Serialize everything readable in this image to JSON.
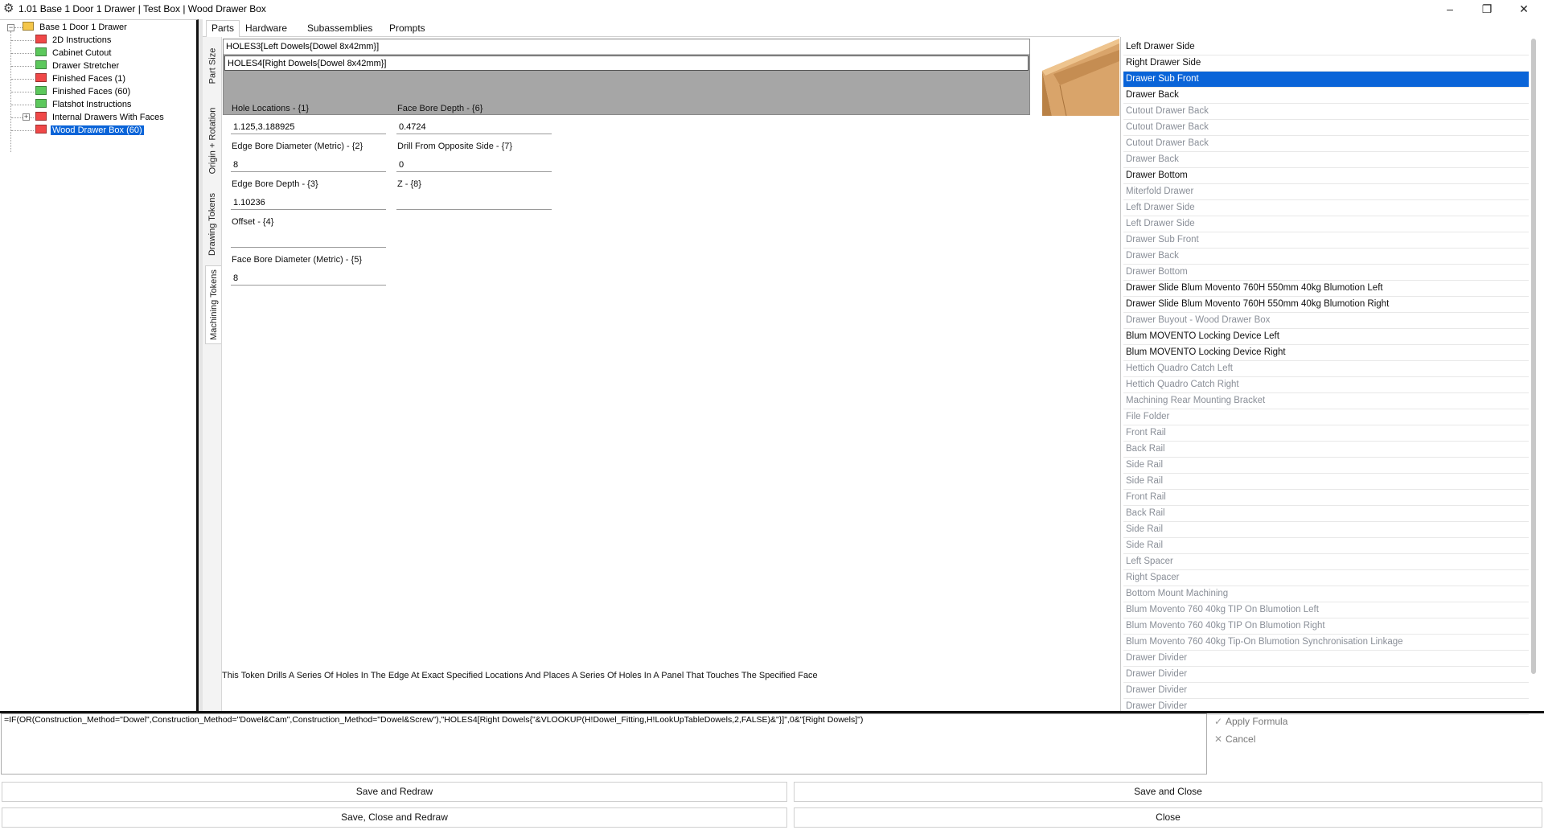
{
  "window": {
    "title": "1.01 Base 1 Door 1 Drawer | Test Box | Wood Drawer Box",
    "app_icon": "gear-icon",
    "controls": {
      "minimize": "–",
      "maximize": "❐",
      "close": "✕"
    }
  },
  "tree": {
    "root": {
      "label": "Base 1 Door 1 Drawer",
      "icon": "folder-open-icon"
    },
    "items": [
      {
        "label": "2D Instructions",
        "color": "red"
      },
      {
        "label": "Cabinet Cutout",
        "color": "green"
      },
      {
        "label": "Drawer Stretcher",
        "color": "green"
      },
      {
        "label": "Finished Faces (1)",
        "color": "red"
      },
      {
        "label": "Finished Faces (60)",
        "color": "green"
      },
      {
        "label": "Flatshot Instructions",
        "color": "green"
      },
      {
        "label": "Internal Drawers With Faces",
        "color": "red",
        "expandable": true
      },
      {
        "label": "Wood Drawer Box (60)",
        "color": "red",
        "selected": true
      }
    ]
  },
  "top_tabs": [
    "Parts",
    "Hardware",
    "Subassemblies",
    "Prompts"
  ],
  "vertical_tabs": [
    "Part Size",
    "Origin + Rotation",
    "Drawing Tokens",
    "Machining Tokens"
  ],
  "tokens": [
    "HOLES3[Left Dowels{Dowel 8x42mm}]",
    "HOLES4[Right Dowels{Dowel 8x42mm}]"
  ],
  "fields": {
    "hole_locations": {
      "label": "Hole Locations - {1}",
      "value": "1.125,3.188925"
    },
    "edge_bore_diameter": {
      "label": "Edge Bore Diameter (Metric) - {2}",
      "value": "8"
    },
    "edge_bore_depth": {
      "label": "Edge Bore Depth - {3}",
      "value": "1.10236"
    },
    "offset": {
      "label": "Offset - {4}",
      "value": ""
    },
    "face_bore_diameter": {
      "label": "Face Bore Diameter (Metric) - {5}",
      "value": "8"
    },
    "face_bore_depth": {
      "label": "Face Bore Depth - {6}",
      "value": "0.4724"
    },
    "drill_opposite": {
      "label": "Drill From Opposite Side - {7}",
      "value": "0"
    },
    "z": {
      "label": "Z - {8}",
      "value": ""
    }
  },
  "description": "This Token Drills A Series Of Holes In The Edge At Exact Specified Locations And Places A Series Of Holes In A Panel That Touches The Specified Face",
  "parts_list": [
    {
      "label": "Left Drawer Side",
      "state": "active"
    },
    {
      "label": "Right Drawer Side",
      "state": "active"
    },
    {
      "label": "Drawer Sub Front",
      "state": "selected"
    },
    {
      "label": "Drawer Back",
      "state": "active"
    },
    {
      "label": "Cutout Drawer Back",
      "state": "inactive"
    },
    {
      "label": "Cutout Drawer Back",
      "state": "inactive"
    },
    {
      "label": "Cutout Drawer Back",
      "state": "inactive"
    },
    {
      "label": "Drawer Back",
      "state": "inactive"
    },
    {
      "label": "Drawer Bottom",
      "state": "active"
    },
    {
      "label": "Miterfold Drawer",
      "state": "inactive"
    },
    {
      "label": "Left Drawer Side",
      "state": "inactive"
    },
    {
      "label": "Left Drawer Side",
      "state": "inactive"
    },
    {
      "label": "Drawer Sub Front",
      "state": "inactive"
    },
    {
      "label": "Drawer Back",
      "state": "inactive"
    },
    {
      "label": "Drawer Bottom",
      "state": "inactive"
    },
    {
      "label": "Drawer Slide Blum Movento 760H 550mm 40kg Blumotion Left",
      "state": "active"
    },
    {
      "label": "Drawer Slide Blum Movento 760H 550mm 40kg Blumotion Right",
      "state": "active"
    },
    {
      "label": "Drawer Buyout - Wood Drawer Box",
      "state": "inactive"
    },
    {
      "label": "Blum MOVENTO Locking Device Left",
      "state": "active"
    },
    {
      "label": "Blum MOVENTO Locking Device Right",
      "state": "active"
    },
    {
      "label": "Hettich Quadro Catch Left",
      "state": "inactive"
    },
    {
      "label": "Hettich Quadro Catch Right",
      "state": "inactive"
    },
    {
      "label": "Machining Rear Mounting Bracket",
      "state": "inactive"
    },
    {
      "label": "File Folder",
      "state": "inactive"
    },
    {
      "label": "Front Rail",
      "state": "inactive"
    },
    {
      "label": "Back Rail",
      "state": "inactive"
    },
    {
      "label": "Side Rail",
      "state": "inactive"
    },
    {
      "label": "Side Rail",
      "state": "inactive"
    },
    {
      "label": "Front Rail",
      "state": "inactive"
    },
    {
      "label": "Back Rail",
      "state": "inactive"
    },
    {
      "label": "Side Rail",
      "state": "inactive"
    },
    {
      "label": "Side Rail",
      "state": "inactive"
    },
    {
      "label": "Left Spacer",
      "state": "inactive"
    },
    {
      "label": "Right Spacer",
      "state": "inactive"
    },
    {
      "label": "Bottom Mount Machining",
      "state": "inactive"
    },
    {
      "label": "Blum Movento 760 40kg TIP On Blumotion Left",
      "state": "inactive"
    },
    {
      "label": "Blum Movento 760 40kg TIP On Blumotion Right",
      "state": "inactive"
    },
    {
      "label": "Blum Movento 760 40kg Tip-On Blumotion Synchronisation Linkage",
      "state": "inactive"
    },
    {
      "label": "Drawer Divider",
      "state": "inactive"
    },
    {
      "label": "Drawer Divider",
      "state": "inactive"
    },
    {
      "label": "Drawer Divider",
      "state": "inactive"
    },
    {
      "label": "Drawer Divider",
      "state": "inactive"
    }
  ],
  "formula": "=IF(OR(Construction_Method=\"Dowel\",Construction_Method=\"Dowel&Cam\",Construction_Method=\"Dowel&Screw\"),\"HOLES4[Right Dowels{\"&VLOOKUP(H!Dowel_Fitting,H!LookUpTableDowels,2,FALSE)&\"}]\",0&\"[Right Dowels]\")",
  "formula_actions": {
    "apply": {
      "label": "Apply Formula",
      "icon": "check-icon"
    },
    "cancel": {
      "label": "Cancel",
      "icon": "x-icon"
    }
  },
  "buttons": {
    "save_redraw": "Save and Redraw",
    "save_close": "Save and Close",
    "save_close_redraw": "Save, Close and Redraw",
    "close": "Close"
  }
}
